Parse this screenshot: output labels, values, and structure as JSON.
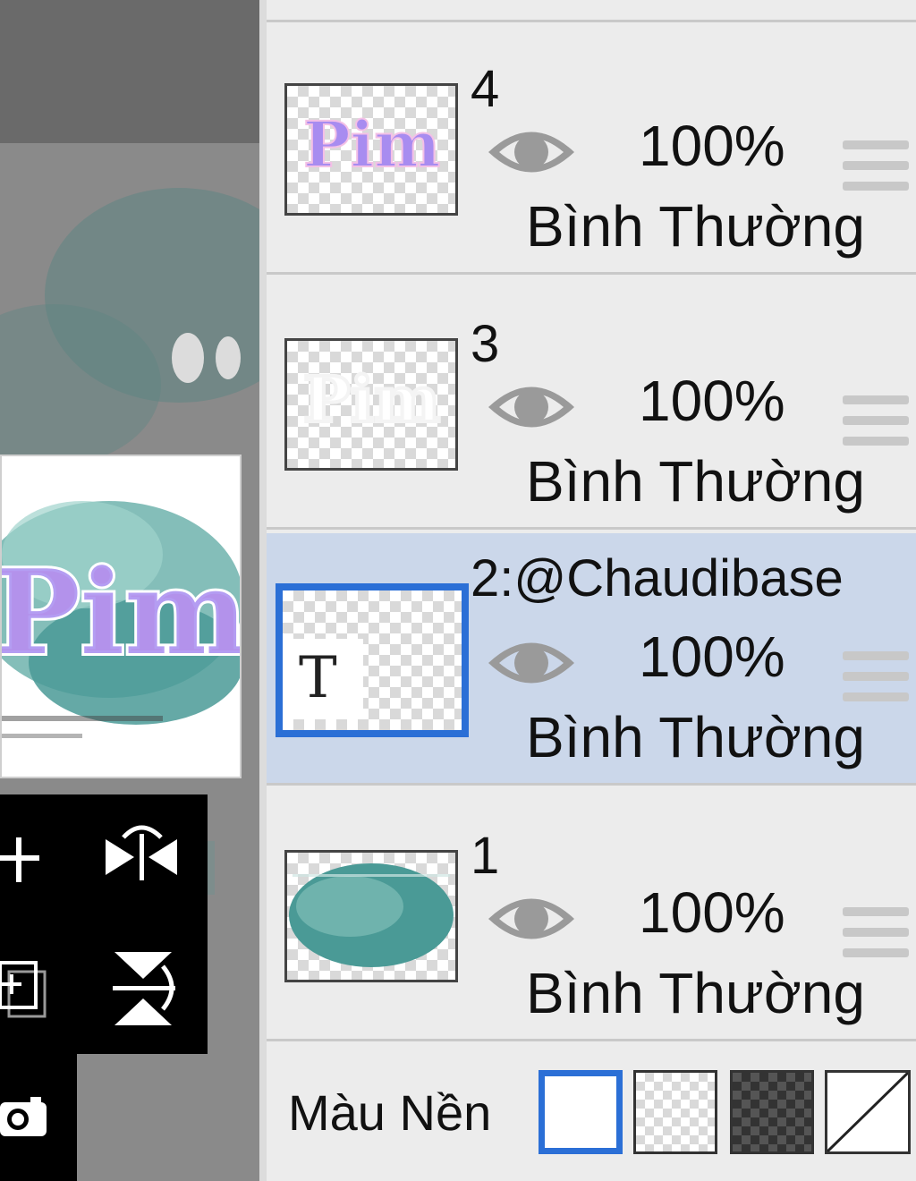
{
  "canvas": {
    "artwork_text": "Pim"
  },
  "toolbar": {
    "icons": [
      "add-layer-icon",
      "flip-horizontal-icon",
      "add-copy-icon",
      "flip-vertical-icon",
      "camera-icon"
    ]
  },
  "layers": [
    {
      "name": "4",
      "opacity": "100%",
      "blend": "Bình Thường",
      "selected": false
    },
    {
      "name": "3",
      "opacity": "100%",
      "blend": "Bình Thường",
      "selected": false
    },
    {
      "name": "2:@Chaudibase",
      "opacity": "100%",
      "blend": "Bình Thường",
      "selected": true,
      "thumb_glyph": "T"
    },
    {
      "name": "1",
      "opacity": "100%",
      "blend": "Bình Thường",
      "selected": false
    }
  ],
  "background_color": {
    "label": "Màu Nền",
    "options": [
      "white",
      "transparent",
      "dark-transparent",
      "none"
    ],
    "selected": "white"
  },
  "colors": {
    "selection_blue": "#2b6fd6",
    "selected_row": "#cbd7ea",
    "teal": "#4a9a96",
    "purple": "#a88cf0"
  }
}
